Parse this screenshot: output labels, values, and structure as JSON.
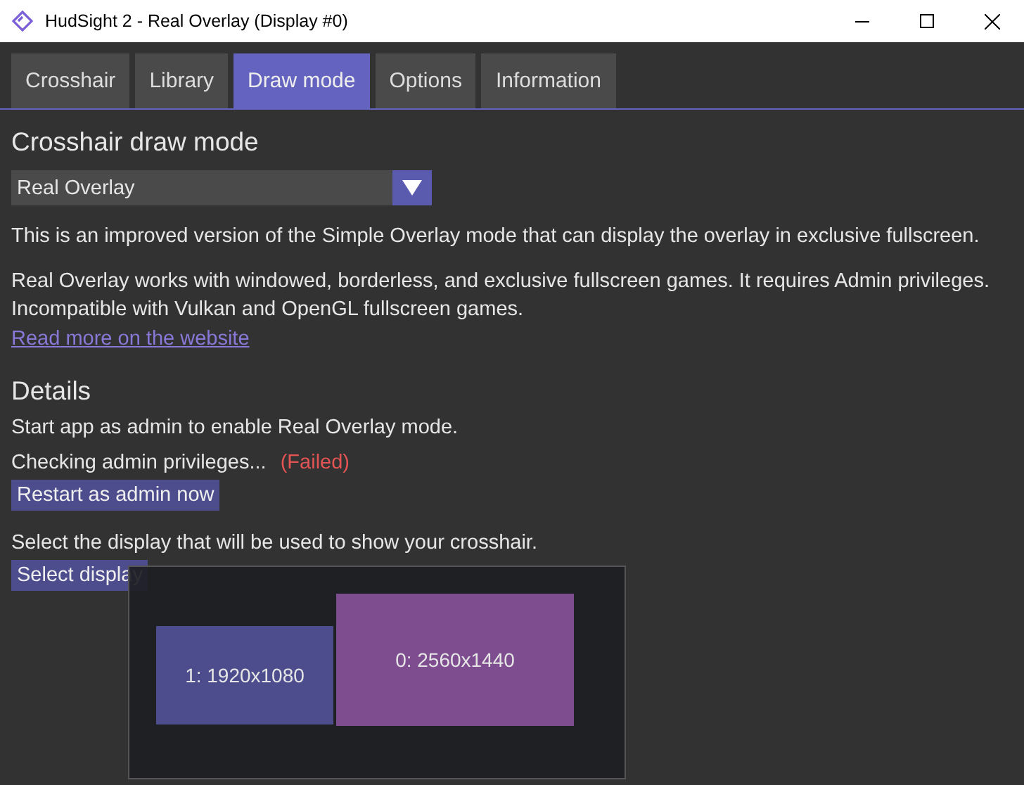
{
  "window": {
    "title": "HudSight 2 - Real Overlay (Display #0)"
  },
  "tabs": [
    {
      "label": "Crosshair",
      "selected": false
    },
    {
      "label": "Library",
      "selected": false
    },
    {
      "label": "Draw mode",
      "selected": true
    },
    {
      "label": "Options",
      "selected": false
    },
    {
      "label": "Information",
      "selected": false
    }
  ],
  "draw_mode": {
    "heading": "Crosshair draw mode",
    "dropdown": {
      "value": "Real Overlay"
    },
    "paragraphs": [
      "This is an improved version of the Simple Overlay mode that can display the overlay in exclusive fullscreen.",
      "Real Overlay works with windowed, borderless, and exclusive fullscreen games. It requires Admin privileges. Incompatible with Vulkan and OpenGL fullscreen games."
    ],
    "link": "Read more on the website"
  },
  "details": {
    "heading": "Details",
    "note": "Start app as admin to enable Real Overlay mode.",
    "check_label": "Checking admin privileges...",
    "check_status": "(Failed)",
    "restart_button": "Restart as admin now",
    "display_prompt": "Select the display that will be used to show your crosshair.",
    "select_button": "Select display"
  },
  "display_picker": {
    "displays": [
      {
        "label": "1: 1920x1080",
        "color": "#4d4d8e"
      },
      {
        "label": "0: 2560x1440",
        "color": "#7d4d8f"
      }
    ]
  }
}
